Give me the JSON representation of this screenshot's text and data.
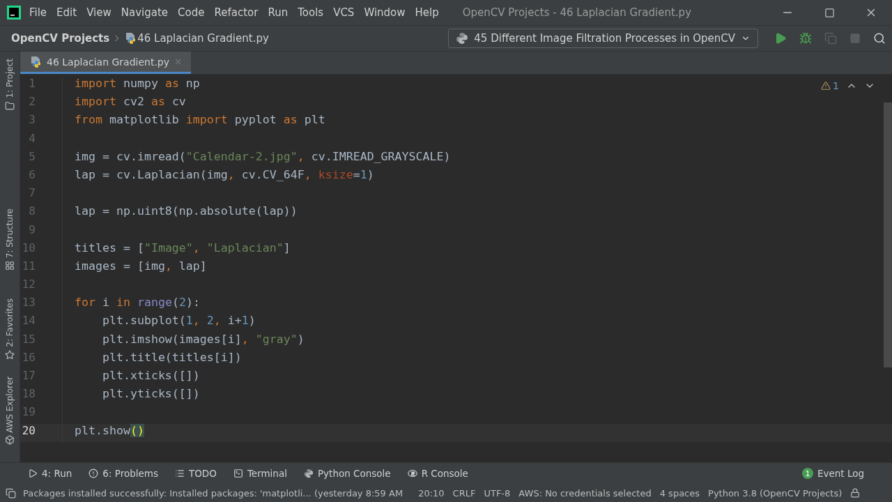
{
  "menu_bar": {
    "items": [
      "File",
      "Edit",
      "View",
      "Navigate",
      "Code",
      "Refactor",
      "Run",
      "Tools",
      "VCS",
      "Window",
      "Help"
    ],
    "title": "OpenCV Projects - 46 Laplacian Gradient.py"
  },
  "navigation_bar": {
    "breadcrumbs": [
      "OpenCV Projects",
      "46 Laplacian Gradient.py"
    ],
    "run_configuration": "45 Different Image Filtration Processes in OpenCV"
  },
  "left_tool_windows": [
    {
      "label": "1: Project",
      "kind": "folder"
    },
    {
      "label": "7: Structure",
      "kind": "structure"
    },
    {
      "label": "2: Favorites",
      "kind": "star"
    },
    {
      "label": "AWS Explorer",
      "kind": "cube"
    }
  ],
  "editor_tabs": [
    {
      "label": "46 Laplacian Gradient.py",
      "selected": true
    }
  ],
  "inspection": {
    "warnings": "1"
  },
  "code": [
    {
      "number": "1",
      "current": false,
      "tokens": [
        {
          "t": "import",
          "kind": "kw"
        },
        {
          "t": " numpy ",
          "kind": "plain"
        },
        {
          "t": "as",
          "kind": "kw"
        },
        {
          "t": " np",
          "kind": "plain"
        }
      ]
    },
    {
      "number": "2",
      "current": false,
      "tokens": [
        {
          "t": "import",
          "kind": "kw"
        },
        {
          "t": " cv2 ",
          "kind": "plain"
        },
        {
          "t": "as",
          "kind": "kw"
        },
        {
          "t": " cv",
          "kind": "plain"
        }
      ]
    },
    {
      "number": "3",
      "current": false,
      "tokens": [
        {
          "t": "from",
          "kind": "kw"
        },
        {
          "t": " matplotlib ",
          "kind": "plain"
        },
        {
          "t": "import",
          "kind": "kw"
        },
        {
          "t": " pyplot ",
          "kind": "plain"
        },
        {
          "t": "as",
          "kind": "kw"
        },
        {
          "t": " plt",
          "kind": "plain"
        }
      ]
    },
    {
      "number": "4",
      "current": false
    },
    {
      "number": "5",
      "current": false,
      "tokens": [
        {
          "t": "img = cv.imread(",
          "kind": "plain"
        },
        {
          "t": "\"Calendar-2.jpg\"",
          "kind": "str"
        },
        {
          "t": ", ",
          "kind": "kw"
        },
        {
          "t": "cv.IMREAD_GRAYSCALE)",
          "kind": "plain"
        }
      ]
    },
    {
      "number": "6",
      "current": false,
      "tokens": [
        {
          "t": "lap = cv.Laplacian(img",
          "kind": "plain"
        },
        {
          "t": ", ",
          "kind": "kw"
        },
        {
          "t": "cv.CV_64F",
          "kind": "plain"
        },
        {
          "t": ", ",
          "kind": "kw"
        },
        {
          "t": "ksize",
          "kind": "param"
        },
        {
          "t": "=",
          "kind": "plain"
        },
        {
          "t": "1",
          "kind": "num"
        },
        {
          "t": ")",
          "kind": "plain"
        }
      ]
    },
    {
      "number": "7",
      "current": false
    },
    {
      "number": "8",
      "current": false,
      "tokens": [
        {
          "t": "lap = np.uint8(np.absolute(lap))",
          "kind": "plain"
        }
      ]
    },
    {
      "number": "9",
      "current": false
    },
    {
      "number": "10",
      "current": false,
      "tokens": [
        {
          "t": "titles = [",
          "kind": "plain"
        },
        {
          "t": "\"Image\"",
          "kind": "str"
        },
        {
          "t": ", ",
          "kind": "kw"
        },
        {
          "t": "\"Laplacian\"",
          "kind": "str"
        },
        {
          "t": "]",
          "kind": "plain"
        }
      ]
    },
    {
      "number": "11",
      "current": false,
      "tokens": [
        {
          "t": "images = [img",
          "kind": "plain"
        },
        {
          "t": ", ",
          "kind": "kw"
        },
        {
          "t": "lap]",
          "kind": "plain"
        }
      ]
    },
    {
      "number": "12",
      "current": false
    },
    {
      "number": "13",
      "current": false,
      "tokens": [
        {
          "t": "for",
          "kind": "kw"
        },
        {
          "t": " i ",
          "kind": "plain"
        },
        {
          "t": "in",
          "kind": "kw"
        },
        {
          "t": " range",
          "kind": "builtin"
        },
        {
          "t": "(",
          "kind": "plain"
        },
        {
          "t": "2",
          "kind": "num"
        },
        {
          "t": "):",
          "kind": "plain"
        }
      ]
    },
    {
      "number": "14",
      "current": false,
      "tokens": [
        {
          "t": "    plt.subplot(",
          "kind": "plain"
        },
        {
          "t": "1",
          "kind": "num"
        },
        {
          "t": ", ",
          "kind": "kw"
        },
        {
          "t": "2",
          "kind": "num"
        },
        {
          "t": ", ",
          "kind": "kw"
        },
        {
          "t": "i+",
          "kind": "plain"
        },
        {
          "t": "1",
          "kind": "num"
        },
        {
          "t": ")",
          "kind": "plain"
        }
      ]
    },
    {
      "number": "15",
      "current": false,
      "tokens": [
        {
          "t": "    plt.imshow(images[i]",
          "kind": "plain"
        },
        {
          "t": ", ",
          "kind": "kw"
        },
        {
          "t": "\"gray\"",
          "kind": "str"
        },
        {
          "t": ")",
          "kind": "plain"
        }
      ]
    },
    {
      "number": "16",
      "current": false,
      "tokens": [
        {
          "t": "    plt.title(titles[i])",
          "kind": "plain"
        }
      ]
    },
    {
      "number": "17",
      "current": false,
      "tokens": [
        {
          "t": "    plt.xticks([])",
          "kind": "plain"
        }
      ]
    },
    {
      "number": "18",
      "current": false,
      "tokens": [
        {
          "t": "    plt.yticks([])",
          "kind": "plain"
        }
      ]
    },
    {
      "number": "19",
      "current": false
    },
    {
      "number": "20",
      "current": true,
      "tokens": [
        {
          "t": "plt.show",
          "kind": "plain"
        },
        {
          "t": "()",
          "kind": "match"
        }
      ]
    }
  ],
  "bottom_tool_windows": [
    {
      "label": "4: Run",
      "kind": "run"
    },
    {
      "label": "6: Problems",
      "kind": "problems"
    },
    {
      "label": "TODO",
      "kind": "todo"
    },
    {
      "label": "Terminal",
      "kind": "terminal"
    },
    {
      "label": "Python Console",
      "kind": "python"
    },
    {
      "label": "R Console",
      "kind": "r"
    }
  ],
  "event_log": {
    "label": "Event Log",
    "count": "1"
  },
  "status_bar": {
    "message": "Packages installed successfully: Installed packages: 'matplotli... (yesterday 8:59 AM",
    "items": [
      "20:10",
      "CRLF",
      "UTF-8",
      "AWS: No credentials selected",
      "4 spaces",
      "Python 3.8 (OpenCV Projects)"
    ]
  }
}
